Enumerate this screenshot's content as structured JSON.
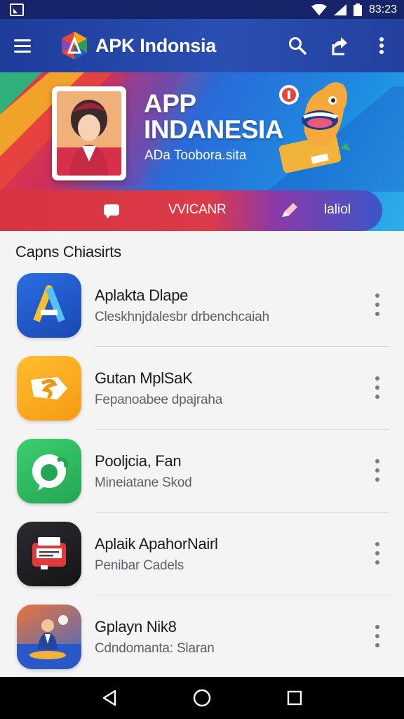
{
  "status_bar": {
    "time": "83:23",
    "icons": [
      "notification-icon",
      "wifi-icon",
      "signal-icon",
      "battery-icon"
    ]
  },
  "app_bar": {
    "title": "APK Indonsia",
    "actions": [
      "search-icon",
      "share-icon",
      "more-vert-icon"
    ]
  },
  "banner": {
    "heading_line1": "APP",
    "heading_line2": "INDANESIA",
    "subtitle": "ADa Toobora.sita",
    "strip_label": "VVICANR",
    "strip_button": "laliol"
  },
  "section": {
    "title": "Capns Chiasirts"
  },
  "apps": [
    {
      "name": "Aplakta Dlape",
      "description": "Cleskhnjdalesbr drbenchcaiah"
    },
    {
      "name": "Gutan MplSaK",
      "description": "Fepanoabee dpajraha"
    },
    {
      "name": "Pooljcia, Fan",
      "description": "Mineiatane Skod"
    },
    {
      "name": "Aplaik ApahorNairl",
      "description": "Penibar Cadels"
    },
    {
      "name": "Gplayn Nik8",
      "description": "Cdndomanta: Slaran"
    }
  ],
  "nav_bar": {
    "buttons": [
      "back-icon",
      "home-icon",
      "recents-icon"
    ]
  },
  "colors": {
    "app_bar": "#2a4fb2",
    "status_bar": "#17246a",
    "background": "#f4f4f5"
  }
}
